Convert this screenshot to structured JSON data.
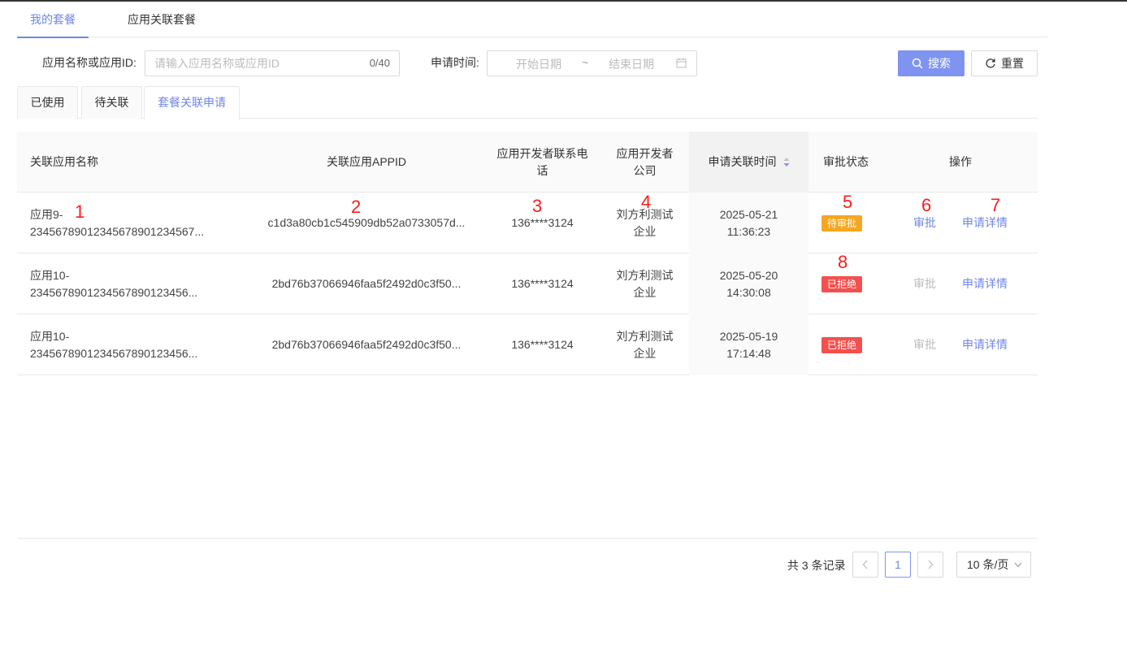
{
  "top_tabs": [
    {
      "label": "我的套餐",
      "active": true
    },
    {
      "label": "应用关联套餐",
      "active": false
    }
  ],
  "filters": {
    "name_label": "应用名称或应用ID:",
    "name_placeholder": "请输入应用名称或应用ID",
    "name_counter": "0/40",
    "time_label": "申请时间:",
    "start_placeholder": "开始日期",
    "separator": "~",
    "end_placeholder": "结束日期",
    "search_label": "搜索",
    "reset_label": "重置"
  },
  "sub_tabs": [
    {
      "label": "已使用",
      "active": false
    },
    {
      "label": "待关联",
      "active": false
    },
    {
      "label": "套餐关联申请",
      "active": true
    }
  ],
  "table": {
    "headers": [
      "关联应用名称",
      "关联应用APPID",
      "应用开发者联系电话",
      "应用开发者公司",
      "申请关联时间",
      "审批状态",
      "操作"
    ],
    "header_lines": {
      "phone": [
        "应用开发者联系电",
        "话"
      ],
      "company": [
        "应用开发者",
        "公司"
      ]
    },
    "rows": [
      {
        "name": [
          "应用9-",
          "23456789012345678901234567..."
        ],
        "appid": "c1d3a80cb1c545909db52a0733057d...",
        "phone": "136****3124",
        "company": [
          "刘方利测试",
          "企业"
        ],
        "time": [
          "2025-05-21",
          "11:36:23"
        ],
        "status": "待审批",
        "status_color": "#f5a623",
        "approve": "审批",
        "approve_enabled": true,
        "detail": "申请详情"
      },
      {
        "name": [
          "应用10-",
          "2345678901234567890123456..."
        ],
        "appid": "2bd76b37066946faa5f2492d0c3f50...",
        "phone": "136****3124",
        "company": [
          "刘方利测试",
          "企业"
        ],
        "time": [
          "2025-05-20",
          "14:30:08"
        ],
        "status": "已拒绝",
        "status_color": "#f5504e",
        "approve": "审批",
        "approve_enabled": false,
        "detail": "申请详情"
      },
      {
        "name": [
          "应用10-",
          "2345678901234567890123456..."
        ],
        "appid": "2bd76b37066946faa5f2492d0c3f50...",
        "phone": "136****3124",
        "company": [
          "刘方利测试",
          "企业"
        ],
        "time": [
          "2025-05-19",
          "17:14:48"
        ],
        "status": "已拒绝",
        "status_color": "#f5504e",
        "approve": "审批",
        "approve_enabled": false,
        "detail": "申请详情"
      }
    ]
  },
  "annotations": [
    "1",
    "2",
    "3",
    "4",
    "5",
    "6",
    "7",
    "8"
  ],
  "pagination": {
    "total_text": "共 3 条记录",
    "current_page": "1",
    "page_size": "10 条/页"
  },
  "colors": {
    "accent": "#6f86e8",
    "primary_button": "#7f93f0",
    "pending": "#f5a623",
    "rejected": "#f5504e",
    "annotation": "#ff1a1a"
  },
  "icons": {
    "search": "search-icon",
    "reset": "refresh-icon",
    "calendar": "calendar-icon",
    "sort": "sort-icon",
    "prev": "chevron-left-icon",
    "next": "chevron-right-icon",
    "dropdown": "chevron-down-icon"
  }
}
